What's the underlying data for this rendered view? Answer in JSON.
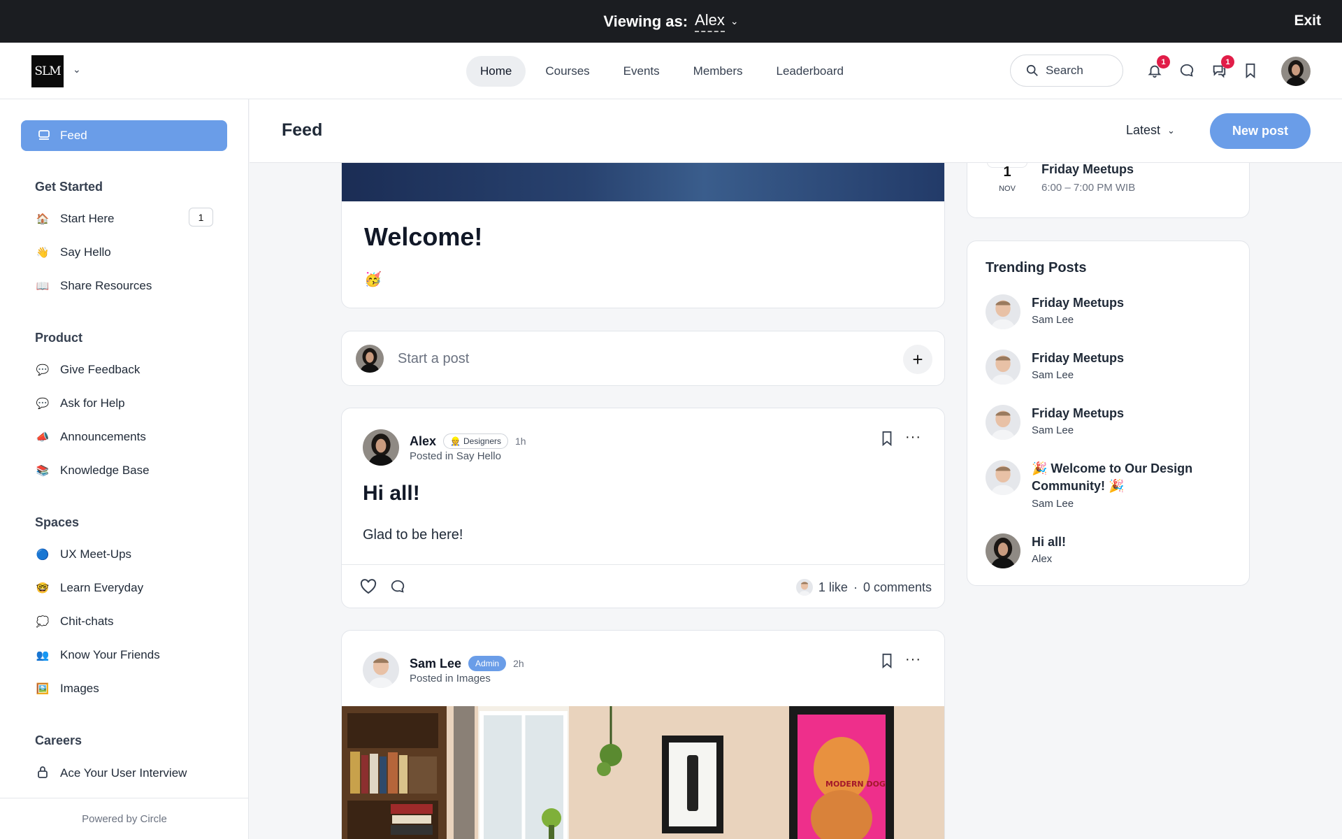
{
  "viewbar": {
    "label": "Viewing as:",
    "name": "Alex",
    "exit": "Exit"
  },
  "header": {
    "logo_text": "SLM",
    "nav": [
      {
        "label": "Home",
        "active": true
      },
      {
        "label": "Courses"
      },
      {
        "label": "Events"
      },
      {
        "label": "Members"
      },
      {
        "label": "Leaderboard"
      }
    ],
    "search_label": "Search",
    "notifications_count": "1",
    "chat_count": "1"
  },
  "sidebar": {
    "feed_label": "Feed",
    "sections": [
      {
        "title": "Get Started",
        "items": [
          {
            "icon": "house-icon",
            "glyph": "🏠",
            "label": "Start Here",
            "count": "1"
          },
          {
            "icon": "wave-icon",
            "glyph": "👋",
            "label": "Say Hello"
          },
          {
            "icon": "book-icon",
            "glyph": "📖",
            "label": "Share Resources"
          }
        ]
      },
      {
        "title": "Product",
        "items": [
          {
            "icon": "speech-bubble-icon",
            "glyph": "💬",
            "label": "Give Feedback"
          },
          {
            "icon": "speech-bubble-icon",
            "glyph": "💬",
            "label": "Ask for Help"
          },
          {
            "icon": "megaphone-icon",
            "glyph": "📣",
            "label": "Announcements"
          },
          {
            "icon": "books-icon",
            "glyph": "📚",
            "label": "Knowledge Base"
          }
        ]
      },
      {
        "title": "Spaces",
        "items": [
          {
            "icon": "blue-circle-icon",
            "glyph": "🔵",
            "label": "UX Meet-Ups"
          },
          {
            "icon": "nerd-face-icon",
            "glyph": "🤓",
            "label": "Learn Everyday"
          },
          {
            "icon": "thought-bubble-icon",
            "glyph": "💭",
            "label": "Chit-chats"
          },
          {
            "icon": "people-icon",
            "glyph": "👥",
            "label": "Know Your Friends"
          },
          {
            "icon": "picture-icon",
            "glyph": "🖼️",
            "label": "Images"
          }
        ]
      },
      {
        "title": "Careers",
        "items": [
          {
            "icon": "lock-icon",
            "glyph": "🔒",
            "label": "Ace Your User Interview"
          }
        ]
      }
    ],
    "powered_by": "Powered by Circle"
  },
  "feedbar": {
    "title": "Feed",
    "sort": "Latest",
    "new_post": "New post"
  },
  "welcome": {
    "title": "Welcome!",
    "emoji": "🥳"
  },
  "start_post": {
    "placeholder": "Start a post"
  },
  "posts": [
    {
      "author": "Alex",
      "tag": "Designers",
      "tag_glyph": "👷",
      "time": "1h",
      "posted_in": "Posted in Say Hello",
      "title": "Hi all!",
      "body": "Glad to be here!",
      "likes": "1 like",
      "sep": "·",
      "comments": "0 comments"
    },
    {
      "author": "Sam Lee",
      "tag": "Admin",
      "time": "2h",
      "posted_in": "Posted in Images",
      "poster_text": "MODERN DOG"
    }
  ],
  "event": {
    "day": "1",
    "month": "NOV",
    "title": "Friday Meetups",
    "time": "6:00 – 7:00 PM WIB"
  },
  "trending": {
    "title": "Trending Posts",
    "items": [
      {
        "title": "Friday Meetups",
        "author": "Sam Lee",
        "avatar": "man"
      },
      {
        "title": "Friday Meetups",
        "author": "Sam Lee",
        "avatar": "man"
      },
      {
        "title": "Friday Meetups",
        "author": "Sam Lee",
        "avatar": "man"
      },
      {
        "title": "🎉 Welcome to Our Design Community! 🎉",
        "author": "Sam Lee",
        "avatar": "man"
      },
      {
        "title": "Hi all!",
        "author": "Alex",
        "avatar": "woman"
      }
    ]
  },
  "colors": {
    "accent": "#6a9de8",
    "topbar": "#1b1d21",
    "badge": "#e11d48"
  }
}
